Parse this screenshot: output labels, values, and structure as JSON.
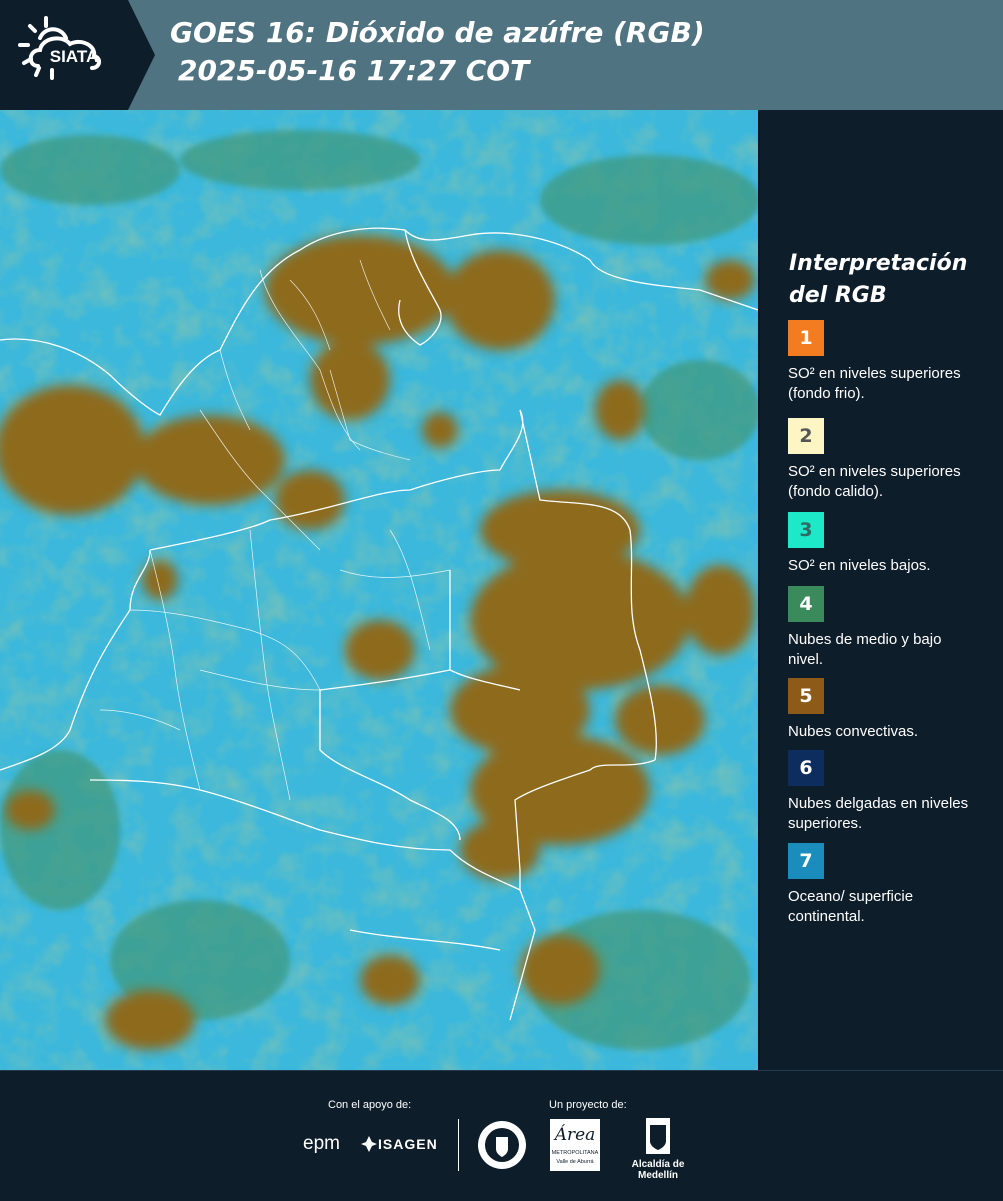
{
  "header": {
    "brand": "SIATA",
    "title_line1": "GOES 16: Dióxido de azúfre (RGB)",
    "title_line2": "2025-05-16 17:27 COT"
  },
  "legend": {
    "title_line1": "Interpretación",
    "title_line2": "del RGB",
    "items": [
      {
        "num": "1",
        "label": "SO² en niveles superiores (fondo frio).",
        "color": "#f47c20",
        "text_color": "#ffffff"
      },
      {
        "num": "2",
        "label": "SO² en niveles superiores (fondo calido).",
        "color": "#fdf5c4",
        "text_color": "#555555"
      },
      {
        "num": "3",
        "label": "SO² en niveles bajos.",
        "color": "#1de9c9",
        "text_color": "#2f6b64"
      },
      {
        "num": "4",
        "label": "Nubes de medio y bajo nivel.",
        "color": "#3a8a5c",
        "text_color": "#ffffff"
      },
      {
        "num": "5",
        "label": "Nubes convectivas.",
        "color": "#8d5a17",
        "text_color": "#ffffff"
      },
      {
        "num": "6",
        "label": "Nubes delgadas en niveles superiores.",
        "color": "#0d2d5e",
        "text_color": "#ffffff"
      },
      {
        "num": "7",
        "label": "Oceano/ superficie continental.",
        "color": "#1a8dbd",
        "text_color": "#ffffff"
      }
    ]
  },
  "footer": {
    "support_label": "Con el apoyo de:",
    "project_label": "Un proyecto de:",
    "epm": "epm",
    "isagen": "ISAGEN",
    "area_word": "Área",
    "area_sub1": "METROPOLITANA",
    "area_sub2": "Valle de Aburrá",
    "alcaldia": "Alcaldía de Medellín"
  },
  "map_colors": {
    "background": "#3bb8dc",
    "convective": "#8d6a1f",
    "mid_low": "#3f9a80",
    "borders": "#ffffff"
  }
}
